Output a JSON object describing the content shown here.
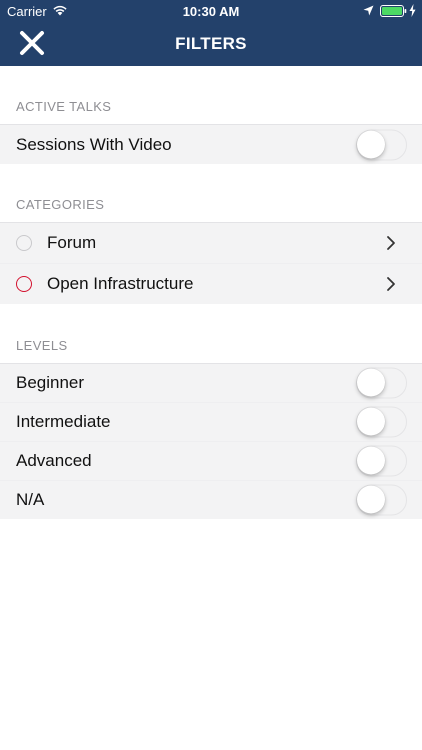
{
  "status_bar": {
    "carrier": "Carrier",
    "time": "10:30 AM"
  },
  "nav": {
    "title": "FILTERS",
    "close_icon": "close-icon"
  },
  "sections": {
    "active_talks": {
      "header": "ACTIVE TALKS",
      "items": [
        {
          "label": "Sessions With Video",
          "on": false
        }
      ]
    },
    "categories": {
      "header": "CATEGORIES",
      "items": [
        {
          "label": "Forum",
          "color": "#c9c9cc"
        },
        {
          "label": "Open Infrastructure",
          "color": "#d3112e"
        }
      ]
    },
    "levels": {
      "header": "LEVELS",
      "items": [
        {
          "label": "Beginner",
          "on": false
        },
        {
          "label": "Intermediate",
          "on": false
        },
        {
          "label": "Advanced",
          "on": false
        },
        {
          "label": "N/A",
          "on": false
        }
      ]
    }
  },
  "colors": {
    "header_bg": "#23416b",
    "row_bg": "#f3f3f4",
    "accent_red": "#d3112e"
  }
}
